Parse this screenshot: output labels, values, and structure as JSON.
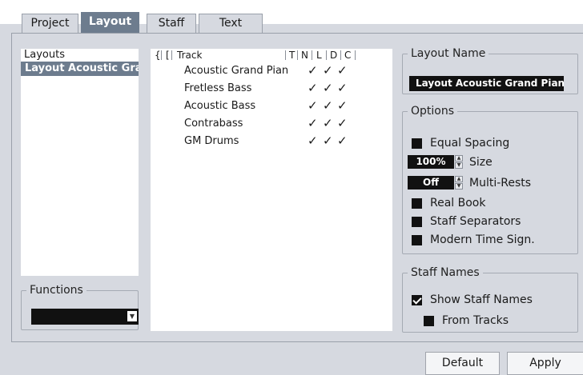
{
  "tabs": [
    {
      "label": "Project",
      "active": false
    },
    {
      "label": "Layout",
      "active": true
    },
    {
      "label": "Staff",
      "active": false
    },
    {
      "label": "Text",
      "active": false
    }
  ],
  "layouts_list": {
    "header": "Layouts",
    "selected": "Layout Acoustic Gra"
  },
  "functions": {
    "legend": "Functions",
    "dropdown_value": ""
  },
  "track_table": {
    "columns": {
      "bracket1": "{",
      "bracket2": "[",
      "track": "Track",
      "t": "T",
      "n": "N",
      "l": "L",
      "d": "D",
      "c": "C"
    },
    "rows": [
      {
        "name": "Acoustic Grand Pian",
        "n": "✓",
        "l": "✓",
        "d": "✓"
      },
      {
        "name": "Fretless Bass",
        "n": "✓",
        "l": "✓",
        "d": "✓"
      },
      {
        "name": "Acoustic Bass",
        "n": "✓",
        "l": "✓",
        "d": "✓"
      },
      {
        "name": "Contrabass",
        "n": "✓",
        "l": "✓",
        "d": "✓"
      },
      {
        "name": "GM Drums",
        "n": "✓",
        "l": "✓",
        "d": "✓"
      }
    ]
  },
  "layout_name": {
    "legend": "Layout Name",
    "value": "Layout Acoustic Grand Piano"
  },
  "options": {
    "legend": "Options",
    "equal_spacing": {
      "label": "Equal Spacing",
      "checked": false
    },
    "size": {
      "value": "100%",
      "label": "Size"
    },
    "multi_rests": {
      "value": "Off",
      "label": "Multi-Rests"
    },
    "real_book": {
      "label": "Real Book",
      "checked": false
    },
    "staff_separators": {
      "label": "Staff Separators",
      "checked": false
    },
    "modern_time_sign": {
      "label": "Modern Time Sign.",
      "checked": false
    }
  },
  "staff_names": {
    "legend": "Staff Names",
    "show_staff_names": {
      "label": "Show Staff Names",
      "checked": true
    },
    "from_tracks": {
      "label": "From Tracks",
      "checked": false
    }
  },
  "buttons": {
    "default": "Default",
    "apply": "Apply"
  },
  "colors": {
    "background": "#d6d9e0",
    "accent": "#6d7c8e",
    "field": "#111111"
  },
  "icons": {
    "spin_up": "spin-up-icon",
    "spin_down": "spin-down-icon",
    "dropdown": "chevron-down-icon",
    "checkmark": "checkmark-icon"
  }
}
